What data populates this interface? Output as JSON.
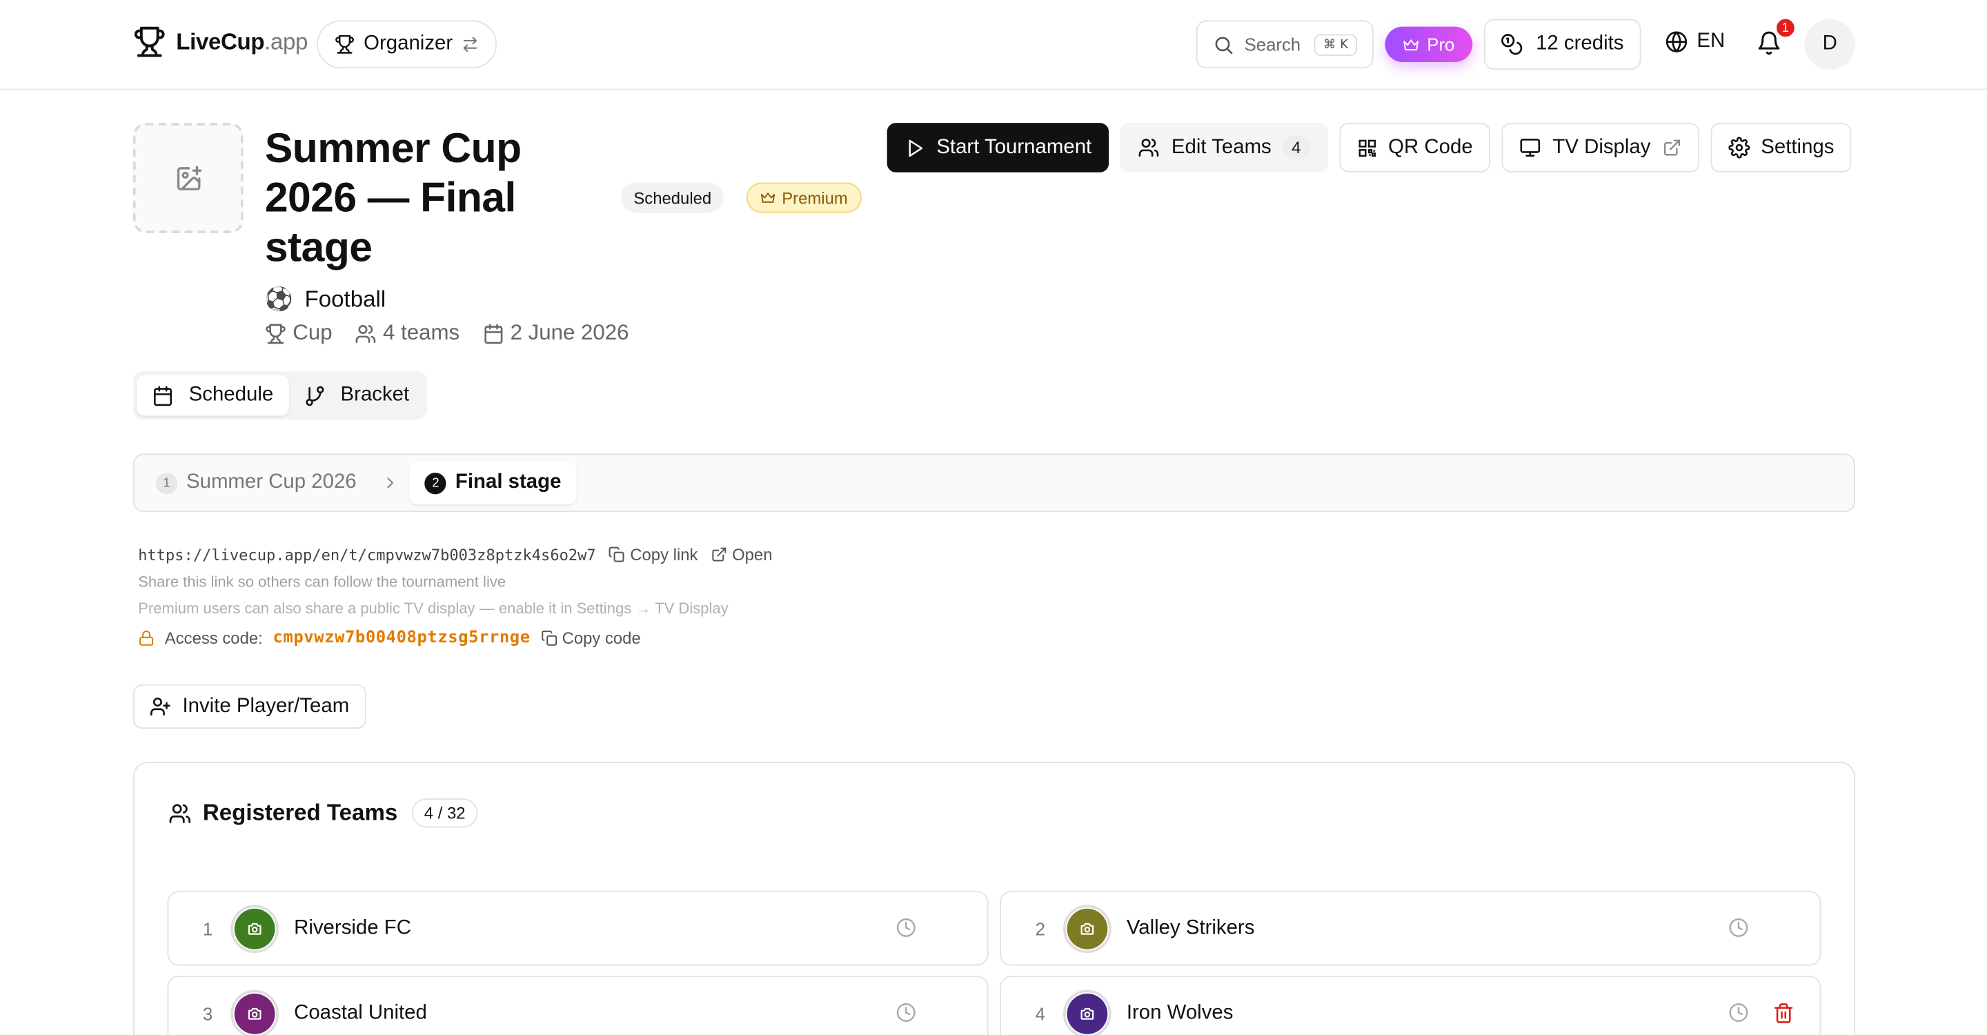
{
  "header": {
    "brand_main": "LiveCup",
    "brand_suffix": ".app",
    "role_label": "Organizer",
    "search_placeholder": "Search",
    "search_shortcut": "⌘ K",
    "pro_label": "Pro",
    "credits_label": "12 credits",
    "language": "EN",
    "notification_count": "1",
    "avatar_initial": "D"
  },
  "tournament": {
    "title": "Summer Cup 2026 — Final stage",
    "status": "Scheduled",
    "tier": "Premium",
    "sport_icon": "⚽",
    "sport": "Football",
    "format": "Cup",
    "teams_count": "4 teams",
    "date": "2 June 2026"
  },
  "actions": {
    "start": "Start Tournament",
    "edit_teams": "Edit Teams",
    "edit_teams_count": "4",
    "qr": "QR Code",
    "tv": "TV Display",
    "settings": "Settings"
  },
  "view_tabs": {
    "schedule": "Schedule",
    "bracket": "Bracket"
  },
  "stages": [
    {
      "num": "1",
      "label": "Summer Cup 2026"
    },
    {
      "num": "2",
      "label": "Final stage"
    }
  ],
  "share": {
    "url": "https://livecup.app/en/t/cmpvwzw7b003z8ptzk4s6o2w7",
    "copy_link": "Copy link",
    "open": "Open",
    "hint": "Share this link so others can follow the tournament live",
    "premium_hint": "Premium users can also share a public TV display — enable it in Settings → TV Display",
    "access_label": "Access code:",
    "access_code": "cmpvwzw7b00408ptzsg5rrnge",
    "copy_code": "Copy code"
  },
  "invite_label": "Invite Player/Team",
  "registered": {
    "title": "Registered Teams",
    "capacity": "4 / 32",
    "teams": [
      {
        "num": "1",
        "name": "Riverside FC",
        "color": "#3f7d21"
      },
      {
        "num": "2",
        "name": "Valley Strikers",
        "color": "#7f7a24"
      },
      {
        "num": "3",
        "name": "Coastal United",
        "color": "#7a2278"
      },
      {
        "num": "4",
        "name": "Iron Wolves",
        "color": "#4a2685"
      }
    ]
  },
  "colors": {
    "accent_dark": "#111111",
    "pro_gradient_start": "#a04dff",
    "pro_gradient_end": "#e54ef0",
    "access_code": "#e07a00",
    "danger": "#e11d1d"
  }
}
